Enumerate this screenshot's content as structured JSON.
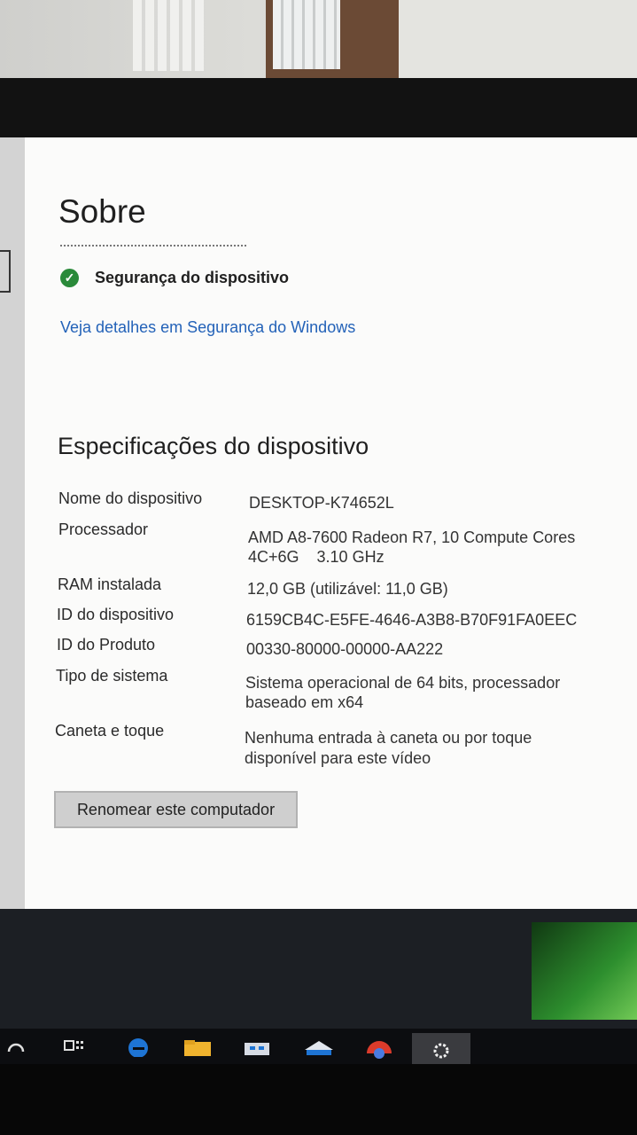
{
  "page": {
    "title": "Sobre",
    "security_status": "Segurança do dispositivo",
    "security_link": "Veja detalhes em Segurança do Windows"
  },
  "specs": {
    "heading": "Especificações do dispositivo",
    "rows": [
      {
        "label": "Nome do dispositivo",
        "value": "DESKTOP-K74652L"
      },
      {
        "label": "Processador",
        "value": "AMD A8-7600 Radeon R7, 10 Compute Cores",
        "value2": "4C+6G    3.10 GHz"
      },
      {
        "label": "RAM instalada",
        "value": "12,0 GB (utilizável: 11,0 GB)"
      },
      {
        "label": "ID do dispositivo",
        "value": "6159CB4C-E5FE-4646-A3B8-B70F91FA0EEC"
      },
      {
        "label": "ID do Produto",
        "value": "00330-80000-00000-AA222"
      },
      {
        "label": "Tipo de sistema",
        "value": "Sistema operacional de 64 bits, processador",
        "value2": "baseado em x64"
      },
      {
        "label": "Caneta e toque",
        "value": "Nenhuma entrada à caneta ou por toque",
        "value2": "disponível para este vídeo"
      }
    ],
    "rename_button": "Renomear este computador"
  },
  "taskbar": {
    "icons": [
      "search-icon",
      "task-view-icon",
      "edge-icon",
      "file-explorer-icon",
      "store-icon",
      "mail-icon",
      "chrome-icon",
      "settings-icon"
    ],
    "accent": "#2362b8"
  }
}
